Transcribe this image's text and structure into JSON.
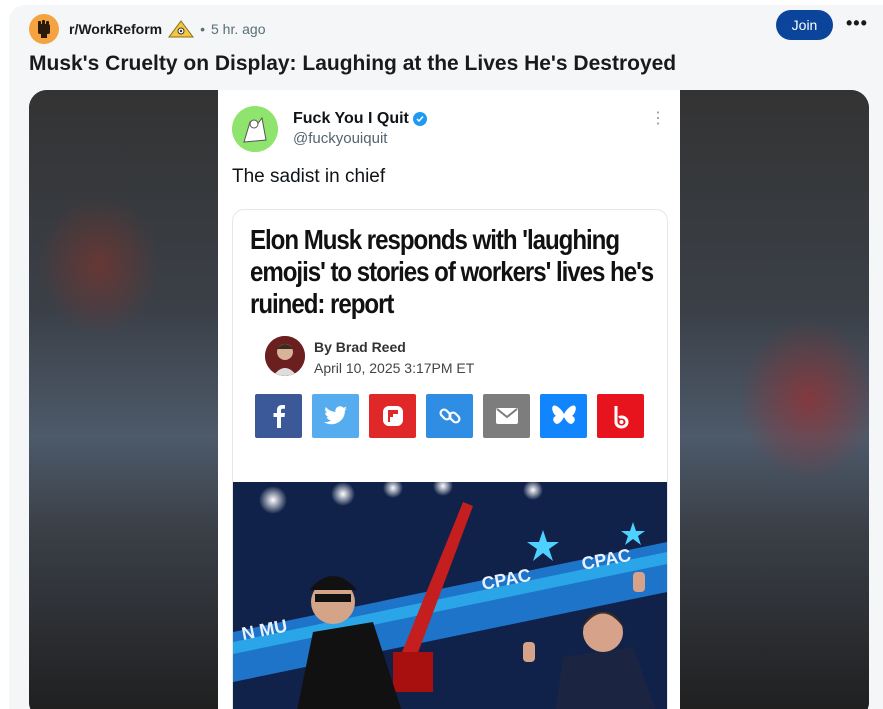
{
  "post": {
    "subreddit": "r/WorkReform",
    "separator": "•",
    "time": "5 hr. ago",
    "join_label": "Join",
    "more_label": "•••",
    "title": "Musk's Cruelty on Display: Laughing at the Lives He's Destroyed"
  },
  "tweet": {
    "name": "Fuck You I Quit",
    "handle": "@fuckyouiquit",
    "text": "The sadist in chief",
    "menu_label": "⋮",
    "article": {
      "headline": "Elon Musk responds with 'laughing emojis' to stories of workers' lives he's ruined: report",
      "byline": "By Brad Reed",
      "date": "April 10, 2025 3:17PM ET",
      "photo_banner": "N MU",
      "photo_cpac_1": "CPAC",
      "photo_cpac_2": "CPAC"
    },
    "share_buttons": [
      {
        "name": "facebook",
        "color": "#3b5998"
      },
      {
        "name": "twitter",
        "color": "#55acee"
      },
      {
        "name": "flipboard",
        "color": "#e12828"
      },
      {
        "name": "link",
        "color": "#2f8de4"
      },
      {
        "name": "email",
        "color": "#7d7d7d"
      },
      {
        "name": "bluesky",
        "color": "#1185fe"
      },
      {
        "name": "bluesky-alt",
        "color": "#e8141d"
      }
    ]
  },
  "colors": {
    "join": "#0a449b",
    "verified": "#1d9bf0"
  }
}
